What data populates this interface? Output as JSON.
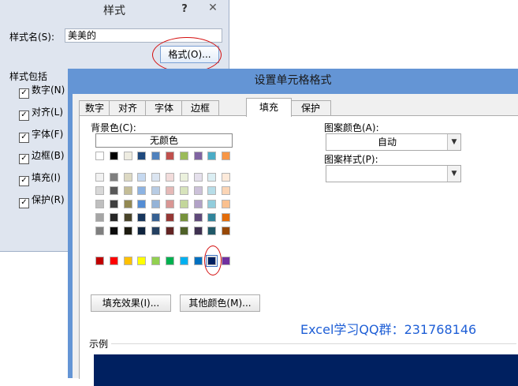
{
  "style_dialog": {
    "title": "样式",
    "help_label": "?",
    "close_label": "✕",
    "style_name_label": "样式名(S):",
    "style_name_value": "美美的",
    "format_button": "格式(O)...",
    "includes_label": "样式包括",
    "checkboxes": [
      {
        "label": "数字(N)",
        "checked": true
      },
      {
        "label": "对齐(L)",
        "checked": true
      },
      {
        "label": "字体(F)",
        "checked": true
      },
      {
        "label": "边框(B)",
        "checked": true
      },
      {
        "label": "填充(I)",
        "checked": true
      },
      {
        "label": "保护(R)",
        "checked": true
      }
    ]
  },
  "format_cells": {
    "title": "设置单元格格式",
    "tabs": [
      "数字",
      "对齐",
      "字体",
      "边框",
      "填充",
      "保护"
    ],
    "active_tab": "填充",
    "background_color_label": "背景色(C):",
    "no_color_button": "无颜色",
    "palette_top": [
      "#ffffff",
      "#000000",
      "#eeece1",
      "#1f497d",
      "#4f81bd",
      "#c0504d",
      "#9bbb59",
      "#8064a2",
      "#4bacc6",
      "#f79646"
    ],
    "palette_theme": [
      [
        "#f2f2f2",
        "#7f7f7f",
        "#ddd9c3",
        "#c6d9f0",
        "#dbe5f1",
        "#f2dcdb",
        "#ebf1dd",
        "#e5e0ec",
        "#dbeef3",
        "#fdeada"
      ],
      [
        "#d8d8d8",
        "#595959",
        "#c4bd97",
        "#8db3e2",
        "#b8cce4",
        "#e5b9b7",
        "#d7e3bc",
        "#ccc1d9",
        "#b7dde8",
        "#fbd5b5"
      ],
      [
        "#bfbfbf",
        "#3f3f3f",
        "#938953",
        "#548dd4",
        "#95b3d7",
        "#d99694",
        "#c3d69b",
        "#b2a2c7",
        "#92cddc",
        "#fac08f"
      ],
      [
        "#a5a5a5",
        "#262626",
        "#494429",
        "#17365d",
        "#366092",
        "#953734",
        "#76923c",
        "#5f497a",
        "#31859b",
        "#e36c09"
      ],
      [
        "#7f7f7f",
        "#0c0c0c",
        "#1d1b10",
        "#0f243e",
        "#244061",
        "#632423",
        "#4f6128",
        "#3f3151",
        "#205867",
        "#974806"
      ]
    ],
    "palette_standard": [
      "#c00000",
      "#ff0000",
      "#ffc000",
      "#ffff00",
      "#92d050",
      "#00b050",
      "#00b0f0",
      "#0070c0",
      "#002060",
      "#7030a0"
    ],
    "selected_color": "#002060",
    "fill_effects_button": "填充效果(I)...",
    "more_colors_button": "其他颜色(M)...",
    "pattern_color_label": "图案颜色(A):",
    "pattern_color_value": "自动",
    "pattern_style_label": "图案样式(P):",
    "pattern_style_value": "",
    "watermark": "Excel学习QQ群：231768146",
    "sample_label": "示例",
    "sample_color": "#002060",
    "accent_color": "#6495d5",
    "annotation_color": "#d40c0c"
  }
}
